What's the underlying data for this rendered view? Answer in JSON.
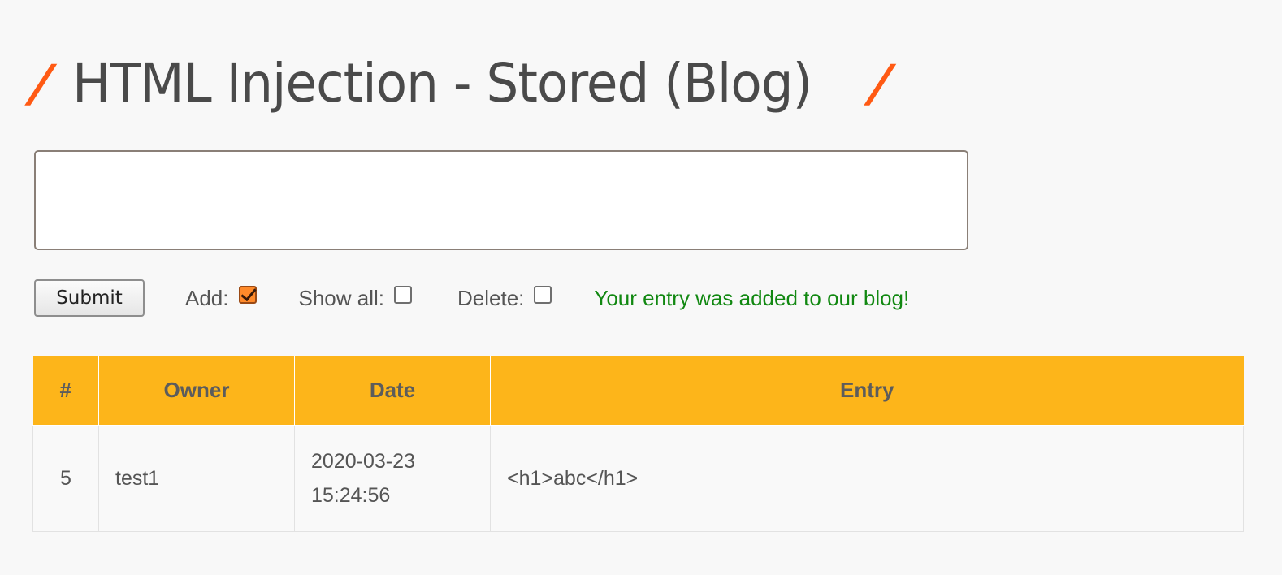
{
  "page": {
    "title": "HTML Injection - Stored (Blog)"
  },
  "form": {
    "entry_value": "",
    "submit_label": "Submit",
    "add_label": "Add:",
    "add_checked": true,
    "show_all_label": "Show all:",
    "show_all_checked": false,
    "delete_label": "Delete:",
    "delete_checked": false,
    "status_message": "Your entry was added to our blog!"
  },
  "table": {
    "headers": [
      "#",
      "Owner",
      "Date",
      "Entry"
    ],
    "rows": [
      {
        "id": "5",
        "owner": "test1",
        "date": "2020-03-23",
        "time": "15:24:56",
        "entry": "<h1>abc</h1>"
      }
    ]
  },
  "colors": {
    "accent_slash": "#ff5a14",
    "header_bg": "#fdb51a",
    "status_text": "#118811"
  }
}
